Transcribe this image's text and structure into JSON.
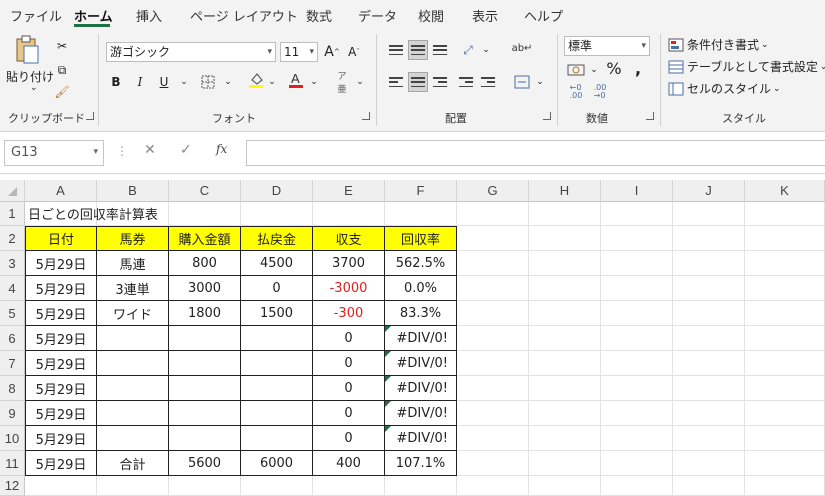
{
  "menu": [
    "ファイル",
    "ホーム",
    "挿入",
    "ページ レイアウト",
    "数式",
    "データ",
    "校閲",
    "表示",
    "ヘルプ"
  ],
  "ribbon": {
    "clipboard": {
      "paste_label": "貼り付け",
      "group_label": "クリップボード"
    },
    "font": {
      "font_name": "游ゴシック",
      "font_size": "11",
      "group_label": "フォント"
    },
    "alignment": {
      "group_label": "配置"
    },
    "number": {
      "format": "標準",
      "group_label": "数値"
    },
    "styles": {
      "conditional": "条件付き書式",
      "table": "テーブルとして書式設定",
      "cell_styles": "セルのスタイル",
      "group_label": "スタイル"
    }
  },
  "formula_bar": {
    "name_box": "G13",
    "formula": ""
  },
  "columns": [
    "A",
    "B",
    "C",
    "D",
    "E",
    "F",
    "G",
    "H",
    "I",
    "J",
    "K"
  ],
  "rows": [
    "1",
    "2",
    "3",
    "4",
    "5",
    "6",
    "7",
    "8",
    "9",
    "10",
    "11",
    "12"
  ],
  "sheet": {
    "title": "日ごとの回収率計算表",
    "headers": [
      "日付",
      "馬券",
      "購入金額",
      "払戻金",
      "収支",
      "回収率"
    ],
    "data": [
      [
        "5月29日",
        "馬連",
        "800",
        "4500",
        "3700",
        "562.5%"
      ],
      [
        "5月29日",
        "3連単",
        "3000",
        "0",
        "-3000",
        "0.0%"
      ],
      [
        "5月29日",
        "ワイド",
        "1800",
        "1500",
        "-300",
        "83.3%"
      ],
      [
        "5月29日",
        "",
        "",
        "",
        "0",
        "#DIV/0!"
      ],
      [
        "5月29日",
        "",
        "",
        "",
        "0",
        "#DIV/0!"
      ],
      [
        "5月29日",
        "",
        "",
        "",
        "0",
        "#DIV/0!"
      ],
      [
        "5月29日",
        "",
        "",
        "",
        "0",
        "#DIV/0!"
      ],
      [
        "5月29日",
        "",
        "",
        "",
        "0",
        "#DIV/0!"
      ],
      [
        "5月29日",
        "合計",
        "5600",
        "6000",
        "400",
        "107.1%"
      ]
    ]
  },
  "colors": {
    "header_fill": "#ffff00",
    "negative": "#e02020",
    "accent": "#1e7145"
  }
}
